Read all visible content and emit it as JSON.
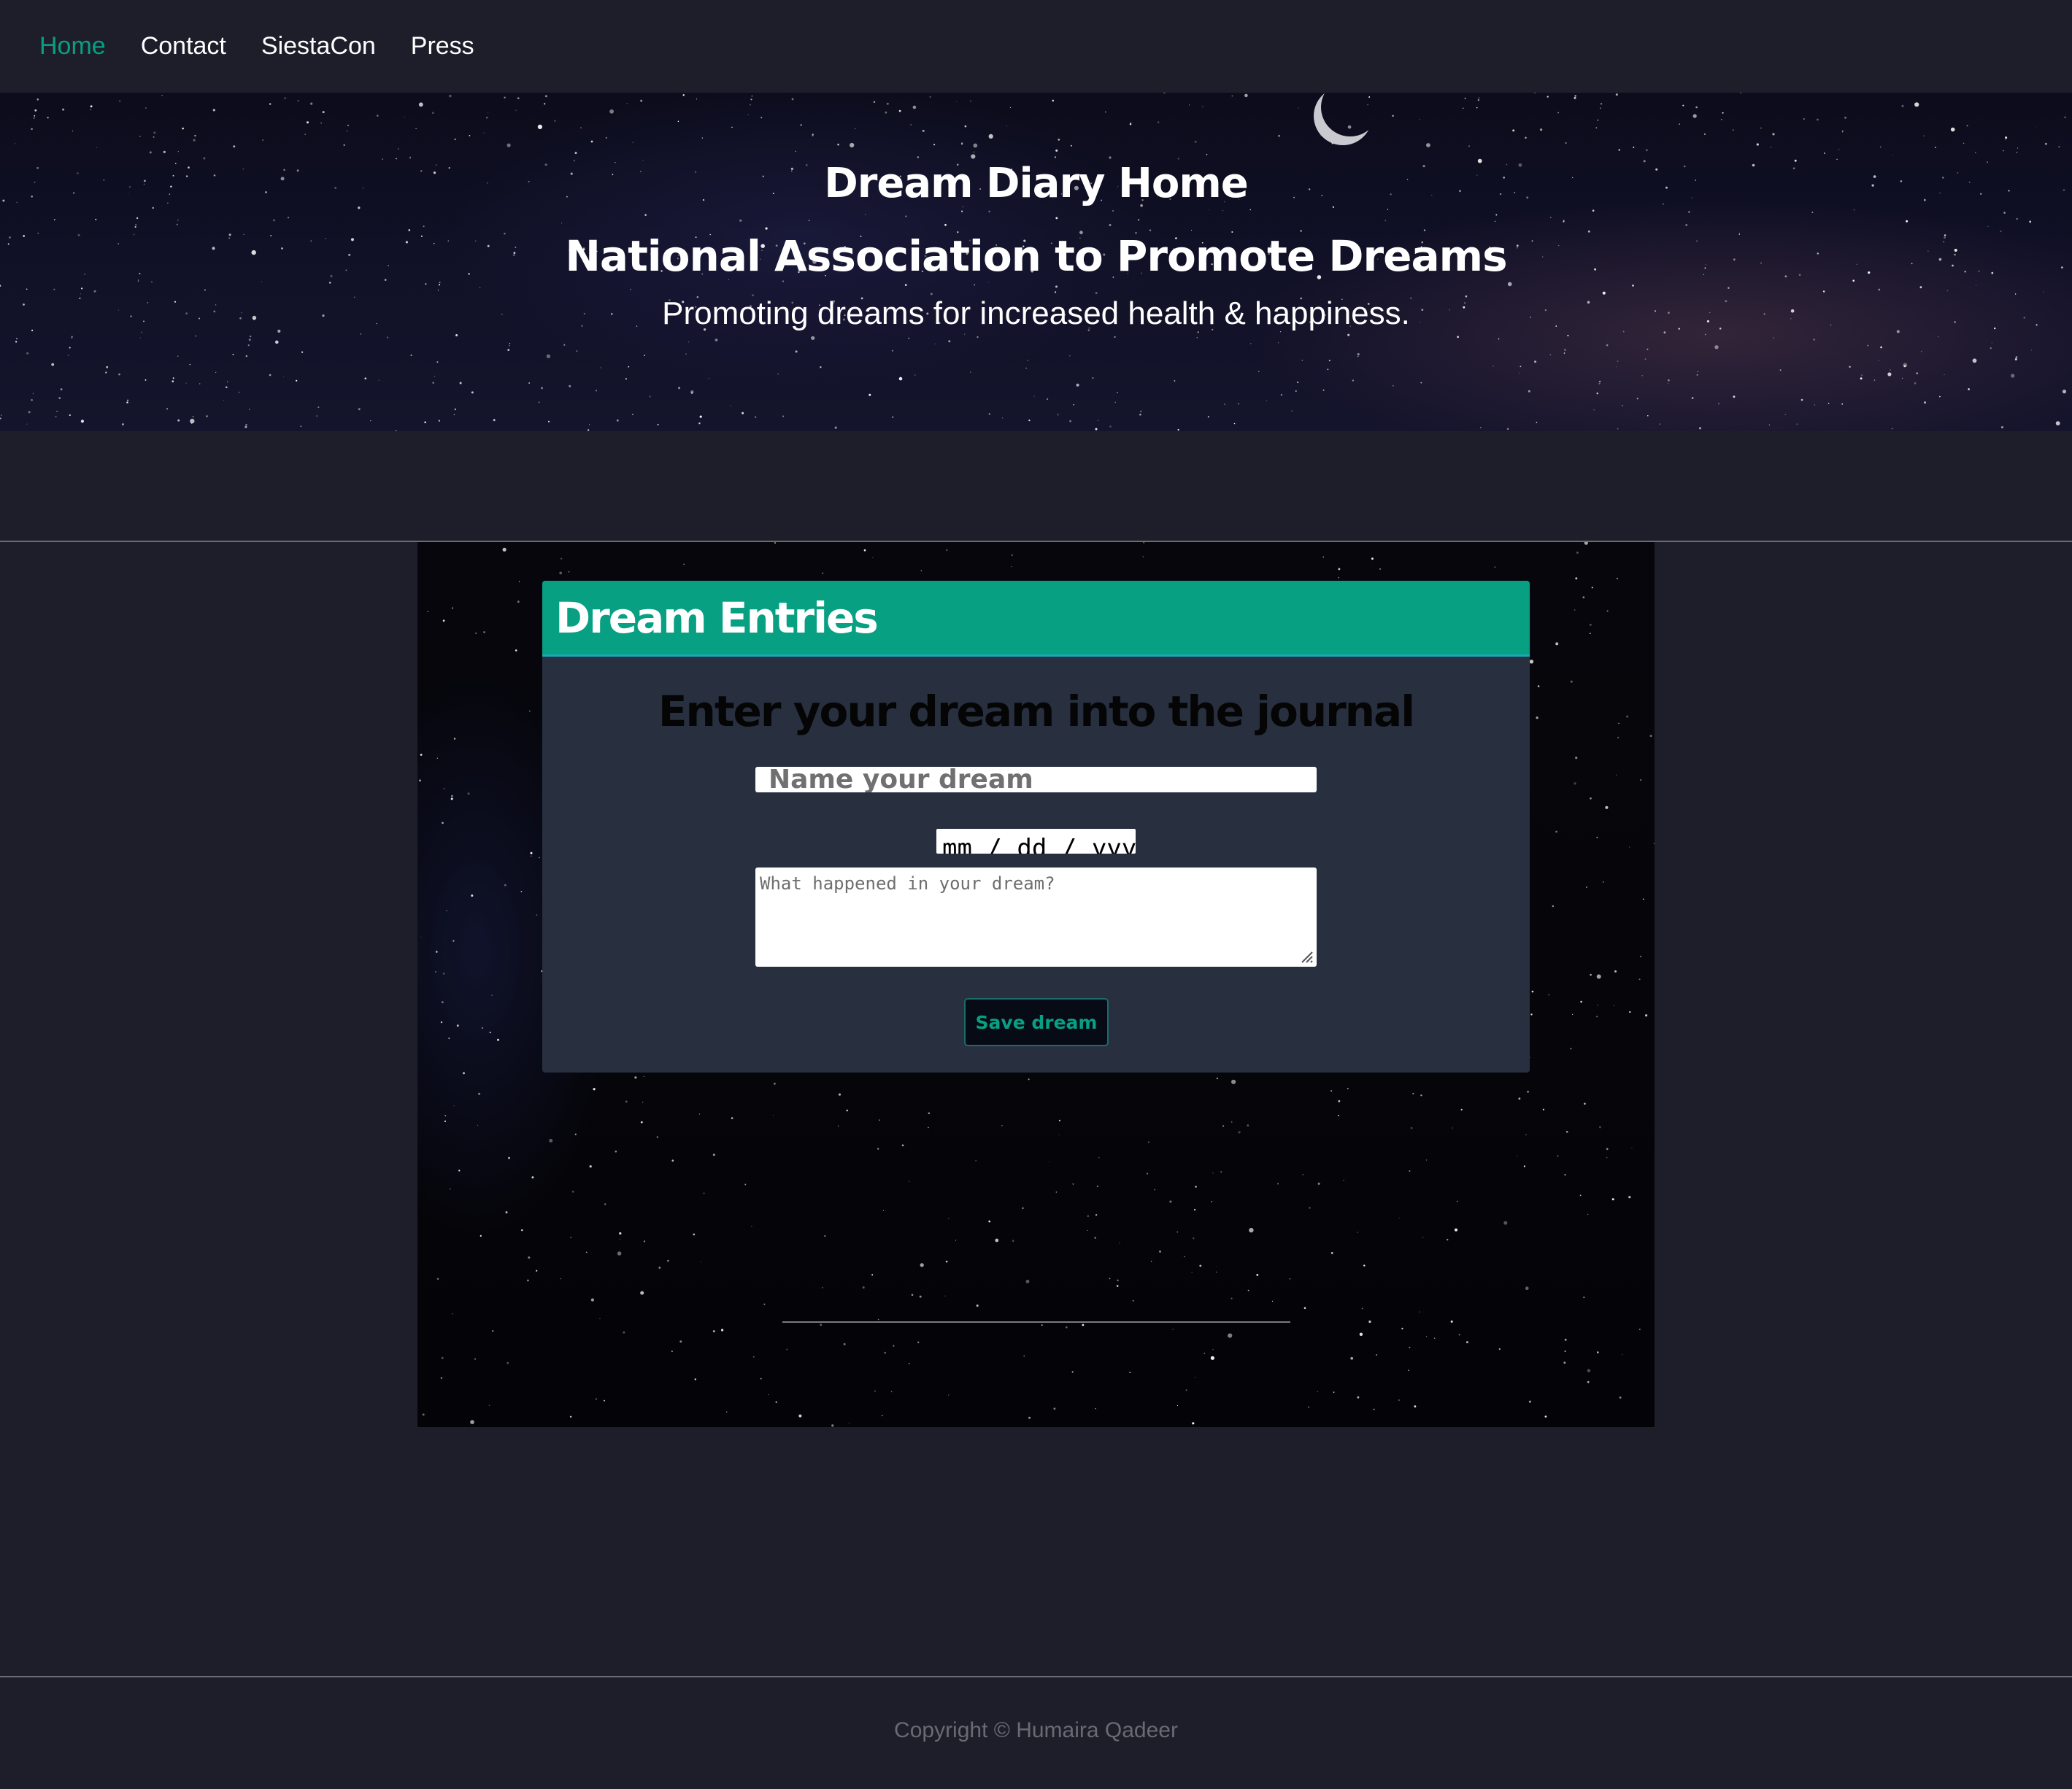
{
  "nav": {
    "items": [
      {
        "label": "Home",
        "active": true
      },
      {
        "label": "Contact",
        "active": false
      },
      {
        "label": "SiestaCon",
        "active": false
      },
      {
        "label": "Press",
        "active": false
      }
    ]
  },
  "hero": {
    "title": "Dream Diary Home",
    "org_name": "National Association to Promote Dreams",
    "tagline": "Promoting dreams for increased health & happiness."
  },
  "entries": {
    "header": "Dream Entries",
    "form_heading": "Enter your dream into the journal",
    "name_placeholder": "Name your dream",
    "date_placeholder": "mm / dd / yyyy",
    "description_placeholder": "What happened in your dream?",
    "save_label": "Save dream"
  },
  "footer": {
    "copyright": "Copyright © Humaira Qadeer"
  },
  "colors": {
    "accent": "#07a083",
    "page_background": "#1e1e2b",
    "card_background": "#283040",
    "text_on_dark": "#ffffff",
    "footer_text": "#6a6a72"
  },
  "icons": {
    "moon": "crescent-moon-icon",
    "resize": "resize-grip-icon"
  }
}
